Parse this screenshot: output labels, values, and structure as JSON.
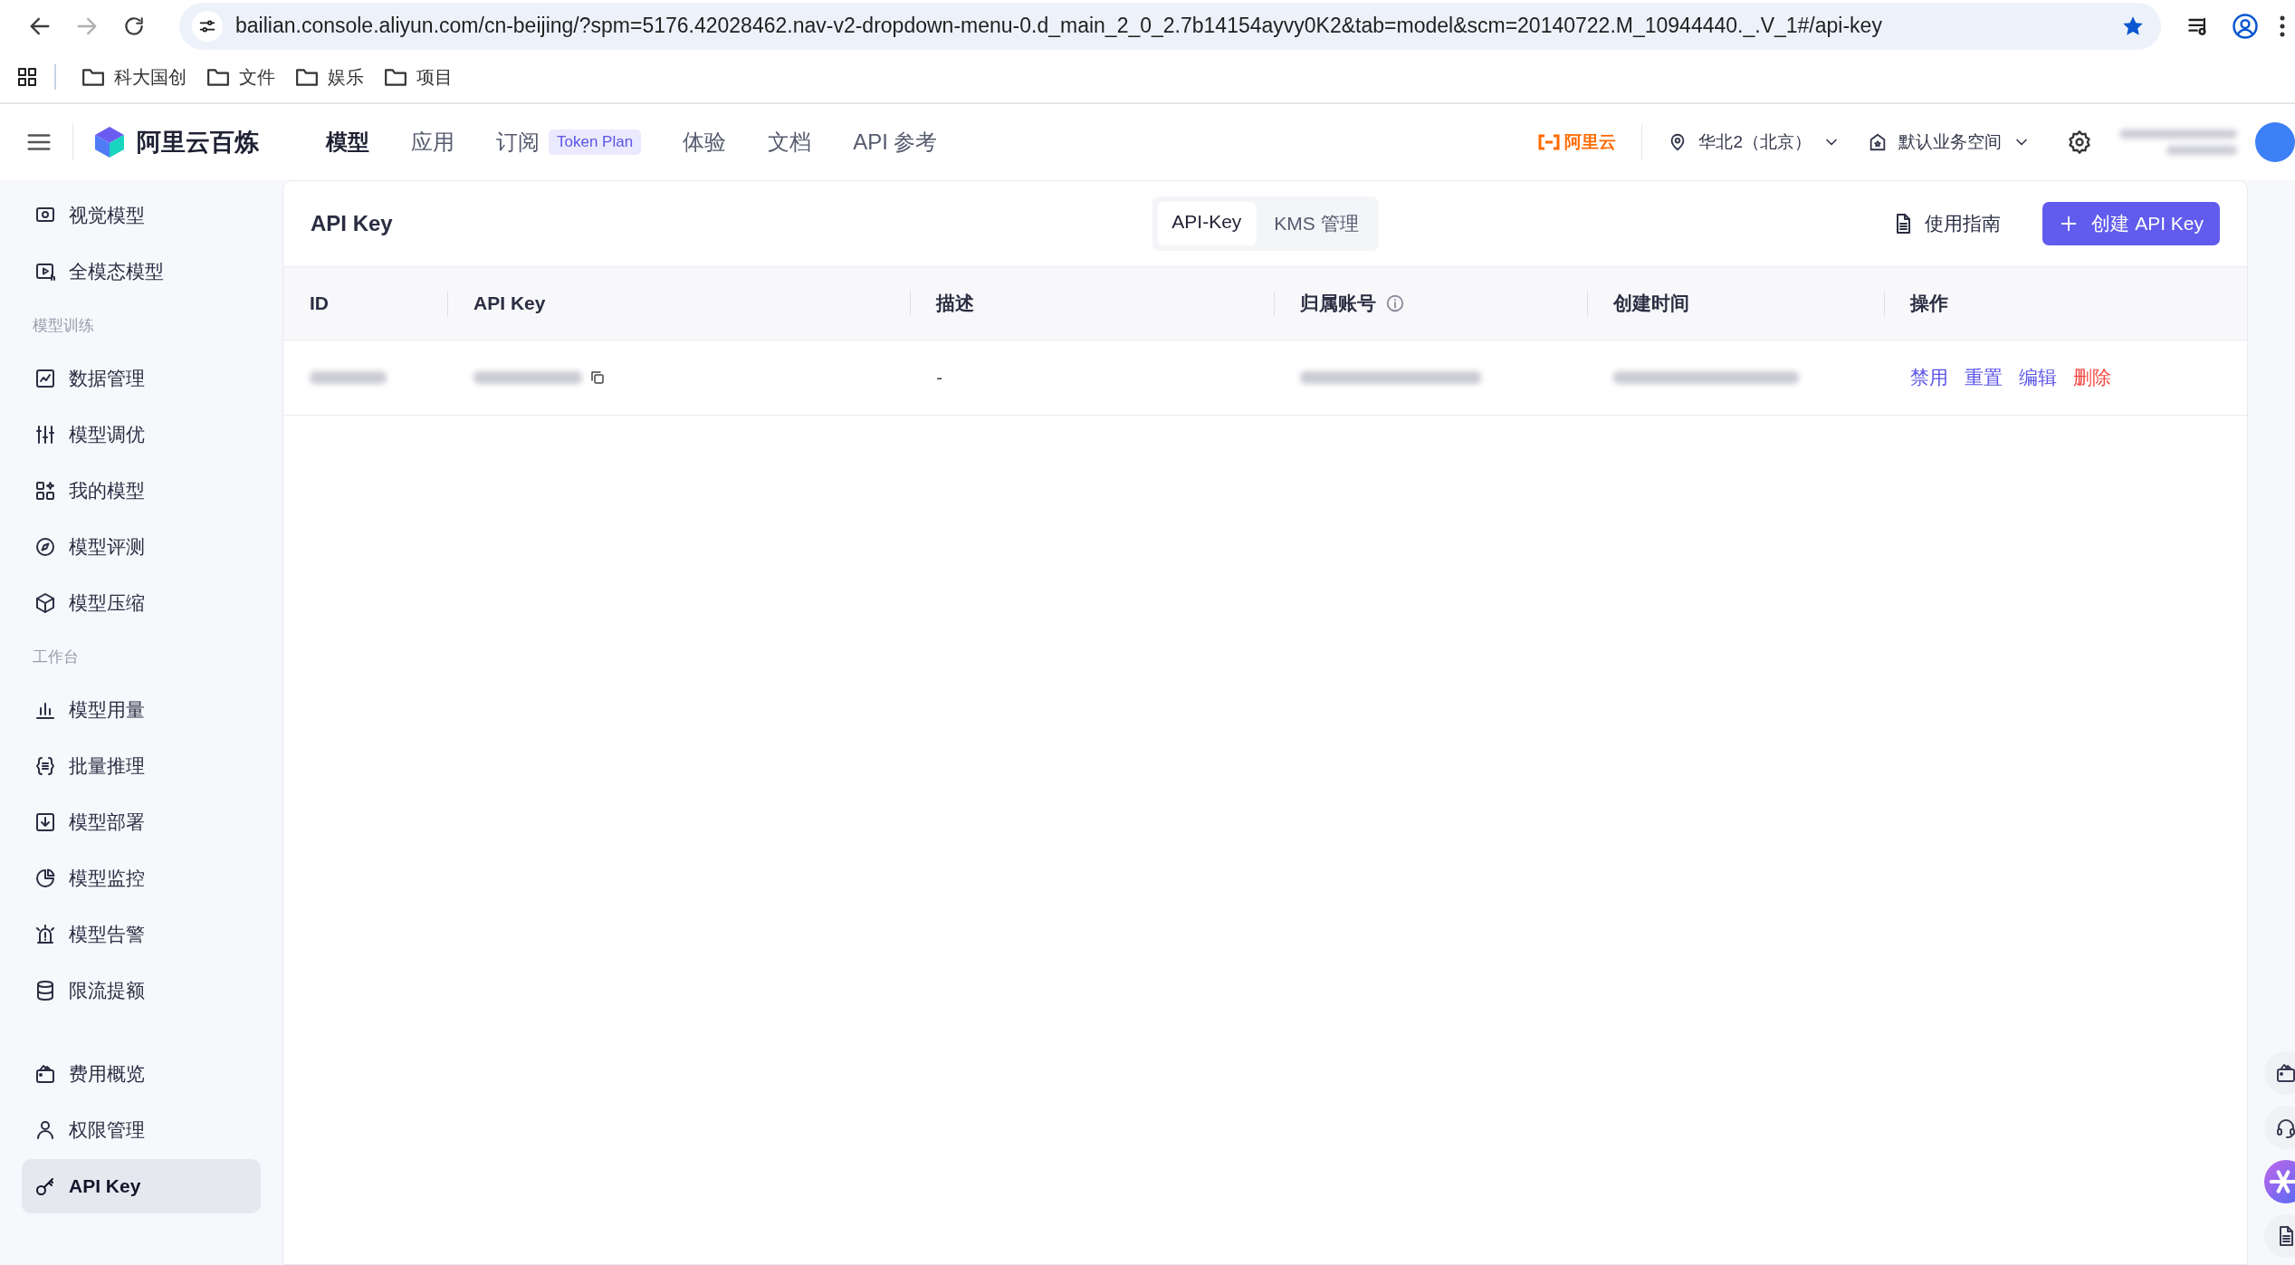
{
  "browser": {
    "url": "bailian.console.aliyun.com/cn-beijing/?spm=5176.42028462.nav-v2-dropdown-menu-0.d_main_2_0_2.7b14154ayvy0K2&tab=model&scm=20140722.M_10944440._.V_1#/api-key",
    "bookmarks": [
      {
        "label": "科大国创"
      },
      {
        "label": "文件"
      },
      {
        "label": "娱乐"
      },
      {
        "label": "项目"
      }
    ]
  },
  "app": {
    "brand": "阿里云百炼",
    "nav": [
      {
        "label": "模型",
        "selected": true
      },
      {
        "label": "应用",
        "selected": false
      },
      {
        "label": "订阅",
        "selected": false,
        "badge": "Token Plan"
      },
      {
        "label": "体验",
        "selected": false
      },
      {
        "label": "文档",
        "selected": false
      },
      {
        "label": "API 参考",
        "selected": false
      }
    ],
    "aliyun": "阿里云",
    "region": "华北2（北京）",
    "workspace": "默认业务空间",
    "account": {
      "kind": "redacted"
    }
  },
  "sidebar": {
    "groups": [
      {
        "items": [
          {
            "label": "视觉模型",
            "selected": false
          },
          {
            "label": "全模态模型",
            "selected": false
          }
        ]
      },
      {
        "title": "模型训练",
        "items": [
          {
            "label": "数据管理",
            "selected": false
          },
          {
            "label": "模型调优",
            "selected": false
          },
          {
            "label": "我的模型",
            "selected": false
          },
          {
            "label": "模型评测",
            "selected": false
          },
          {
            "label": "模型压缩",
            "selected": false
          }
        ]
      },
      {
        "title": "工作台",
        "items": [
          {
            "label": "模型用量",
            "selected": false
          },
          {
            "label": "批量推理",
            "selected": false
          },
          {
            "label": "模型部署",
            "selected": false
          },
          {
            "label": "模型监控",
            "selected": false
          },
          {
            "label": "模型告警",
            "selected": false
          },
          {
            "label": "限流提额",
            "selected": false
          }
        ]
      },
      {
        "items": [
          {
            "label": "费用概览",
            "selected": false
          },
          {
            "label": "权限管理",
            "selected": false
          },
          {
            "label": "API Key",
            "selected": true
          }
        ]
      }
    ]
  },
  "page": {
    "title": "API Key",
    "tabs": [
      {
        "label": "API-Key",
        "selected": true
      },
      {
        "label": "KMS 管理",
        "selected": false
      }
    ],
    "guide": "使用指南",
    "create_button": "创建 API Key",
    "table": {
      "columns": [
        {
          "label": "ID"
        },
        {
          "label": "API Key"
        },
        {
          "label": "描述"
        },
        {
          "label": "归属账号",
          "info": true
        },
        {
          "label": "创建时间"
        },
        {
          "label": "操作"
        }
      ],
      "rows": [
        {
          "cells": [
            {
              "kind": "redacted"
            },
            {
              "kind": "redacted_key"
            },
            {
              "kind": "text",
              "text": "-"
            },
            {
              "kind": "redacted"
            },
            {
              "kind": "redacted"
            }
          ],
          "actions": [
            {
              "label": "禁用",
              "kind": "normal"
            },
            {
              "label": "重置",
              "kind": "normal"
            },
            {
              "label": "编辑",
              "kind": "normal"
            },
            {
              "label": "删除",
              "kind": "danger"
            }
          ]
        }
      ]
    }
  },
  "rail": [
    {
      "kind": "tool"
    },
    {
      "kind": "tool"
    },
    {
      "kind": "assistant"
    },
    {
      "kind": "tool"
    }
  ]
}
